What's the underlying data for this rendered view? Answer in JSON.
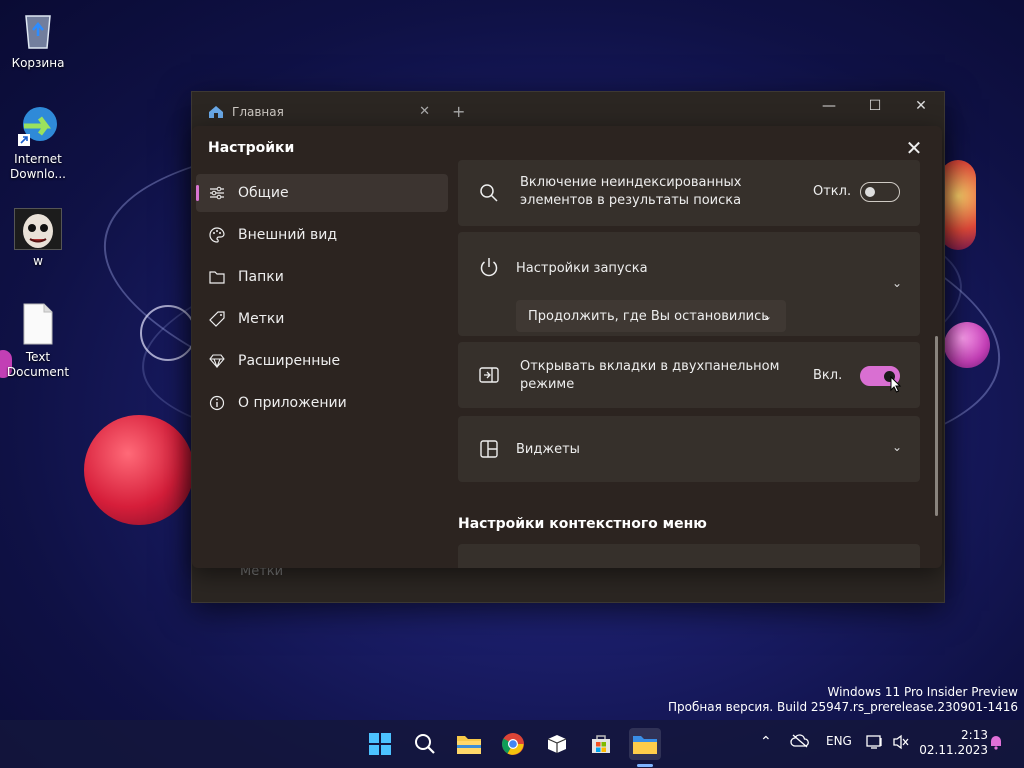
{
  "desktop": {
    "icons": [
      {
        "label": "Корзина",
        "icon": "recycle-bin-icon"
      },
      {
        "label": "Internet Downlo...",
        "icon": "internet-download-manager-icon"
      },
      {
        "label": "w",
        "icon": "face-image-icon"
      },
      {
        "label": "Text Document",
        "icon": "text-document-icon"
      }
    ]
  },
  "window": {
    "tab_title": "Главная",
    "new_tab": "+",
    "behind_item": "Метки"
  },
  "settings": {
    "title": "Настройки",
    "nav": [
      {
        "label": "Общие",
        "icon": "sliders-icon"
      },
      {
        "label": "Внешний вид",
        "icon": "palette-icon"
      },
      {
        "label": "Папки",
        "icon": "folder-icon"
      },
      {
        "label": "Метки",
        "icon": "tag-icon"
      },
      {
        "label": "Расширенные",
        "icon": "gem-icon"
      },
      {
        "label": "О приложении",
        "icon": "info-icon"
      }
    ],
    "cards": {
      "unindexed": {
        "label": "Включение неиндексированных элементов в результаты поиска",
        "state_text": "Откл.",
        "on": false
      },
      "startup": {
        "label": "Настройки запуска",
        "dropdown_value": "Продолжить, где Вы остановились"
      },
      "dual_pane": {
        "label": "Открывать вкладки в двухпанельном режиме",
        "state_text": "Вкл.",
        "on": true
      },
      "widgets": {
        "label": "Виджеты"
      }
    },
    "context_menu_title": "Настройки контекстного меню"
  },
  "watermark": {
    "line1": "Windows 11 Pro Insider Preview",
    "line2": "Пробная версия. Build 25947.rs_prerelease.230901-1416"
  },
  "taskbar": {
    "apps": [
      "start-icon",
      "search-icon",
      "file-explorer-icon",
      "chrome-icon",
      "package-icon",
      "store-icon",
      "files-app-icon"
    ],
    "language": "ENG",
    "time": "2:13",
    "date": "02.11.2023"
  },
  "colors": {
    "accent": "#d96fd2",
    "dialog_bg": "#2c2420",
    "card_bg": "#36302b"
  }
}
